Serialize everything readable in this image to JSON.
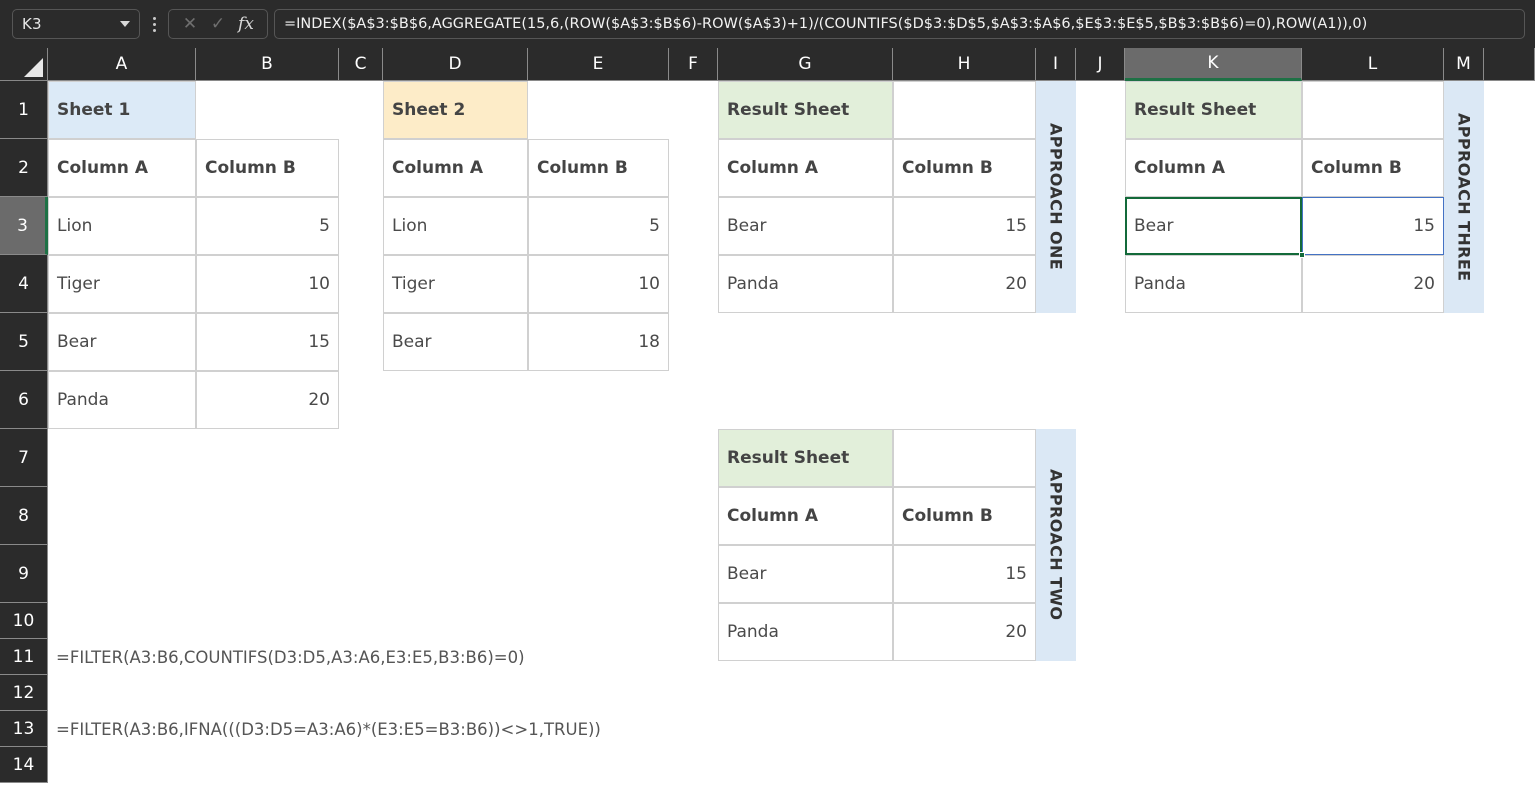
{
  "formula_bar": {
    "name_box_value": "K3",
    "cancel_icon": "close-icon",
    "confirm_icon": "check-icon",
    "function_icon": "fx-icon",
    "formula": "=INDEX($A$3:$B$6,AGGREGATE(15,6,(ROW($A$3:$B$6)-ROW($A$3)+1)/(COUNTIFS($D$3:$D$5,$A$3:$A$6,$E$3:$E$5,$B$3:$B$6)=0),ROW(A1)),0)"
  },
  "grid": {
    "column_headers": [
      "A",
      "B",
      "C",
      "D",
      "E",
      "F",
      "G",
      "H",
      "I",
      "J",
      "K",
      "L",
      "M"
    ],
    "row_headers": [
      "1",
      "2",
      "3",
      "4",
      "5",
      "6",
      "7",
      "8",
      "9",
      "10",
      "11",
      "12",
      "13",
      "14"
    ],
    "active_cell": "K3",
    "active_column": "K",
    "active_row": "3"
  },
  "colors": {
    "sheet1_header": "#dceaf7",
    "sheet2_header": "#fdecc8",
    "result_header": "#e2efda",
    "approach_label": "#dbe8f5",
    "selection": "#136a3a",
    "spill": "#4472c4"
  },
  "tables": {
    "sheet1": {
      "title": "Sheet 1",
      "headers": [
        "Column A",
        "Column B"
      ],
      "rows": [
        [
          "Lion",
          "5"
        ],
        [
          "Tiger",
          "10"
        ],
        [
          "Bear",
          "15"
        ],
        [
          "Panda",
          "20"
        ]
      ]
    },
    "sheet2": {
      "title": "Sheet 2",
      "headers": [
        "Column A",
        "Column B"
      ],
      "rows": [
        [
          "Lion",
          "5"
        ],
        [
          "Tiger",
          "10"
        ],
        [
          "Bear",
          "18"
        ]
      ]
    },
    "result_one": {
      "title": "Result Sheet",
      "headers": [
        "Column A",
        "Column B"
      ],
      "rows": [
        [
          "Bear",
          "15"
        ],
        [
          "Panda",
          "20"
        ]
      ],
      "label": "APPROACH ONE"
    },
    "result_two": {
      "title": "Result Sheet",
      "headers": [
        "Column A",
        "Column B"
      ],
      "rows": [
        [
          "Bear",
          "15"
        ],
        [
          "Panda",
          "20"
        ]
      ],
      "label": "APPROACH TWO"
    },
    "result_three": {
      "title": "Result Sheet",
      "headers": [
        "Column A",
        "Column B"
      ],
      "rows": [
        [
          "Bear",
          "15"
        ],
        [
          "Panda",
          "20"
        ]
      ],
      "label": "APPROACH THREE"
    }
  },
  "notes": {
    "formula_row11": "=FILTER(A3:B6,COUNTIFS(D3:D5,A3:A6,E3:E5,B3:B6)=0)",
    "formula_row13": "=FILTER(A3:B6,IFNA(((D3:D5=A3:A6)*(E3:E5=B3:B6))<>1,TRUE))"
  }
}
